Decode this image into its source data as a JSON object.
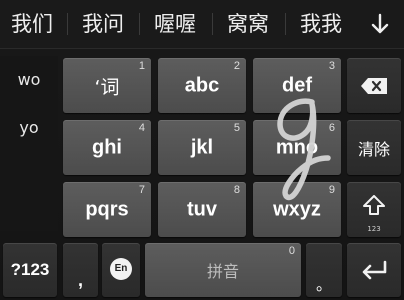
{
  "candidates": [
    "我们",
    "我问",
    "喔喔",
    "窝窝",
    "我我"
  ],
  "collapse_icon": "arrow-down-icon",
  "pinyin_options": [
    "wo",
    "yo"
  ],
  "keys": {
    "k1": {
      "label": "‘词",
      "num": "1"
    },
    "k2": {
      "label": "abc",
      "num": "2"
    },
    "k3": {
      "label": "def",
      "num": "3"
    },
    "k4": {
      "label": "ghi",
      "num": "4"
    },
    "k5": {
      "label": "jkl",
      "num": "5"
    },
    "k6": {
      "label": "mno",
      "num": "6"
    },
    "k7": {
      "label": "pqrs",
      "num": "7"
    },
    "k8": {
      "label": "tuv",
      "num": "8"
    },
    "k9": {
      "label": "wxyz",
      "num": "9"
    },
    "k0": {
      "label": "拼音",
      "num": "0"
    },
    "clear": "清除",
    "symbols": "?123",
    "comma": ",",
    "lang": "En",
    "period": "。",
    "shift_sub": "123"
  },
  "colors": {
    "key_bg": "#555555",
    "dark_key_bg": "#2f2f2f",
    "background": "#181818",
    "stroke": "#d0d0d0"
  }
}
